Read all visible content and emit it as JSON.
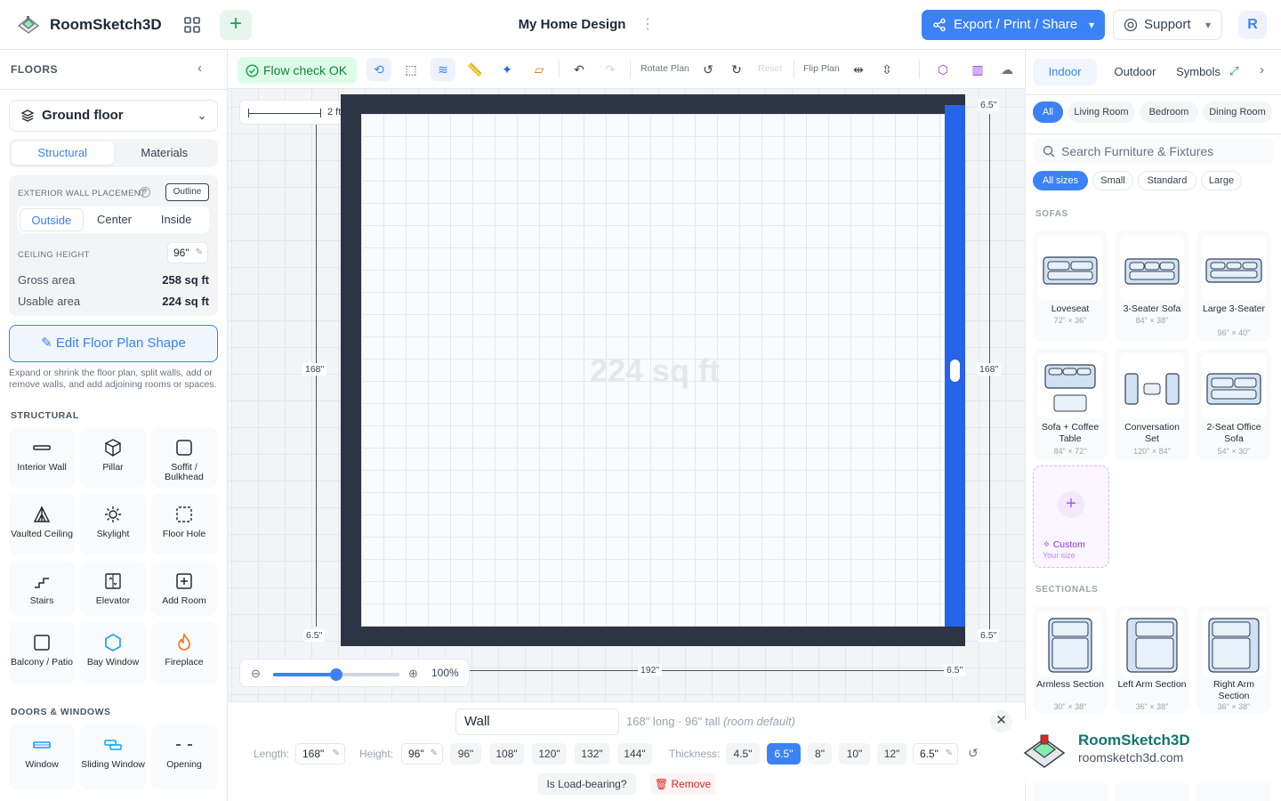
{
  "app": {
    "name": "RoomSketch3D",
    "doc_title": "My Home Design",
    "avatar_initial": "R"
  },
  "header": {
    "export_label": "Export / Print / Share",
    "support_label": "Support"
  },
  "floors": {
    "title": "FLOORS",
    "selected_floor": "Ground floor",
    "tabs": [
      "Structural",
      "Materials"
    ],
    "active_tab": "Structural",
    "wall_placement_label": "EXTERIOR WALL PLACEMENT",
    "outline_label": "Outline",
    "placement_options": [
      "Outside",
      "Center",
      "Inside"
    ],
    "active_placement": "Outside",
    "ceiling_label": "CEILING HEIGHT",
    "ceiling_value": "96\"",
    "gross_label": "Gross area",
    "gross_value": "258 sq ft",
    "usable_label": "Usable area",
    "usable_value": "224 sq ft",
    "edit_shape_label": "Edit Floor Plan Shape",
    "hint": "Expand or shrink the floor plan, split walls, add or remove walls, and add adjoining rooms or spaces.",
    "structural_heading": "STRUCTURAL",
    "structural_tools": [
      "Interior Wall",
      "Pillar",
      "Soffit / Bulkhead",
      "Vaulted Ceiling",
      "Skylight",
      "Floor Hole",
      "Stairs",
      "Elevator",
      "Add Room",
      "Balcony / Patio",
      "Bay Window",
      "Fireplace"
    ],
    "doors_heading": "DOORS & WINDOWS",
    "door_tools": [
      "Window",
      "Sliding Window",
      "Opening"
    ]
  },
  "toolbar": {
    "flow_check": "Flow check OK",
    "rotate_label": "Rotate Plan",
    "reset_label": "Reset",
    "flip_label": "Flip Plan"
  },
  "canvas": {
    "scale_label": "2 ft",
    "area_watermark": "224 sq ft",
    "dim_left": "168\"",
    "dim_right": "168\"",
    "dim_bottom": "192\"",
    "dim_top_right": "6.5\"",
    "dim_bottom_left": "6.5\"",
    "dim_bottom_right": "6.5\"",
    "dim_bottom_corner": "6.5\"",
    "zoom_percent": "100%",
    "zoom_level": 0.5
  },
  "wall_editor": {
    "name": "Wall",
    "description": "168\" long · 96\" tall",
    "description_note": "(room default)",
    "length_label": "Length:",
    "length_value": "168\"",
    "height_label": "Height:",
    "height_value": "96\"",
    "height_presets": [
      "96\"",
      "108\"",
      "120\"",
      "132\"",
      "144\""
    ],
    "thickness_label": "Thickness:",
    "thickness_presets": [
      "4.5\"",
      "6.5\"",
      "8\"",
      "10\"",
      "12\""
    ],
    "thickness_selected": "6.5\"",
    "thickness_value": "6.5\"",
    "load_bearing_label": "Is Load-bearing?",
    "remove_label": "Remove"
  },
  "library": {
    "tabs": [
      "Indoor",
      "Outdoor",
      "Symbols"
    ],
    "active_tab": "Indoor",
    "categories": [
      "All",
      "Living Room",
      "Bedroom",
      "Dining Room"
    ],
    "active_category": "All",
    "search_placeholder": "Search Furniture & Fixtures",
    "sizes": [
      "All sizes",
      "Small",
      "Standard",
      "Large"
    ],
    "active_size": "All sizes",
    "sofas_heading": "SOFAS",
    "sofas": [
      {
        "name": "Loveseat",
        "dims": "72\" × 36\""
      },
      {
        "name": "3-Seater Sofa",
        "dims": "84\" × 38\""
      },
      {
        "name": "Large 3-Seater",
        "dims": "96\" × 40\""
      },
      {
        "name": "Sofa + Coffee Table",
        "dims": "84\" × 72\""
      },
      {
        "name": "Conversation Set",
        "dims": "120\" × 84\""
      },
      {
        "name": "2-Seat Office Sofa",
        "dims": "54\" × 30\""
      }
    ],
    "custom_label": "Custom",
    "custom_sub": "Your size",
    "sectionals_heading": "SECTIONALS",
    "sectionals": [
      {
        "name": "Armless Section",
        "dims": "30\" × 38\""
      },
      {
        "name": "Left Arm Section",
        "dims": "36\" × 38\""
      },
      {
        "name": "Right Arm Section",
        "dims": "36\" × 38\""
      }
    ]
  },
  "brand_badge": {
    "name": "RoomSketch3D",
    "url": "roomsketch3d.com"
  }
}
